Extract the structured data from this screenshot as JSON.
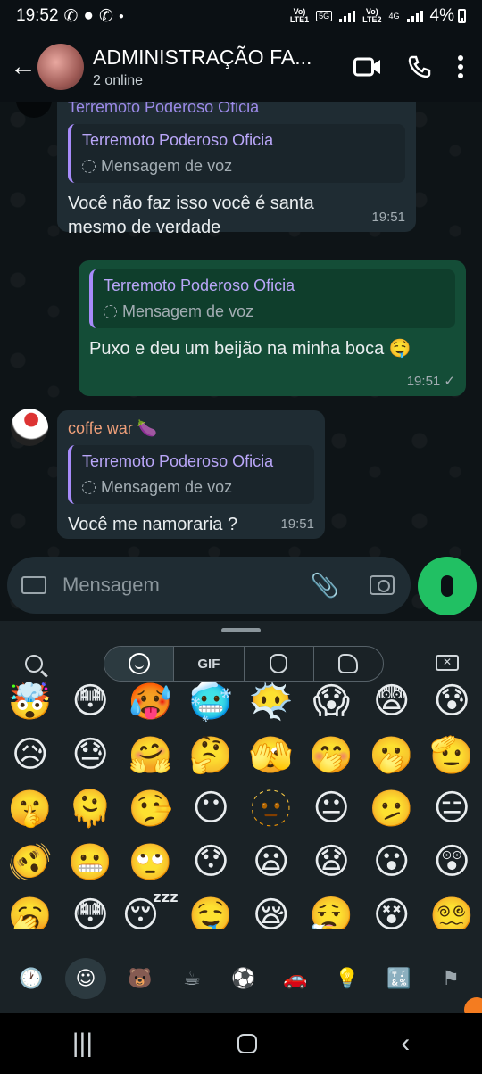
{
  "status": {
    "time": "19:52",
    "sim1": "Vo)\nLTE1",
    "net1": "5G",
    "sim2": "Vo)\nLTE2",
    "net2": "4G",
    "battery": "4%"
  },
  "header": {
    "title": "ADMINISTRAÇÃO FA...",
    "subtitle": "2 online"
  },
  "messages": [
    {
      "sender": "Terremoto Poderoso Oficia",
      "quote_name": "Terremoto Poderoso Oficia",
      "quote_sub": "Mensagem de voz",
      "text": "Você não faz isso você é santa mesmo de verdade",
      "time": "19:51"
    },
    {
      "quote_name": "Terremoto Poderoso Oficia",
      "quote_sub": "Mensagem de voz",
      "text": "Puxo e deu um beijão na minha boca 🤤",
      "time": "19:51 ✓"
    },
    {
      "sender": "coffe war 🍆",
      "quote_name": "Terremoto Poderoso Oficia",
      "quote_sub": "Mensagem de voz",
      "text": "Você me namoraria ?",
      "time": "19:51"
    }
  ],
  "input": {
    "placeholder": "Mensagem"
  },
  "emoji_tabs": {
    "gif": "GIF"
  },
  "emojis": [
    "🤯",
    "😳",
    "🥵",
    "🥶",
    "😶‍🌫️",
    "😱",
    "😨",
    "😰",
    "😥",
    "😓",
    "🤗",
    "🤔",
    "🫣",
    "🤭",
    "🫢",
    "🫡",
    "🤫",
    "🫠",
    "🤥",
    "😶",
    "🫥",
    "😐",
    "🫤",
    "😑",
    "🫨",
    "😬",
    "🙄",
    "😯",
    "😦",
    "😧",
    "😮",
    "😲",
    "🥱",
    "😳",
    "😴",
    "🤤",
    "😪",
    "😮‍💨",
    "😵",
    "😵‍💫"
  ],
  "categories": [
    "🕐",
    "☺",
    "🐻",
    "☕",
    "⚽",
    "🚗",
    "💡",
    "🔣",
    "⚑"
  ]
}
